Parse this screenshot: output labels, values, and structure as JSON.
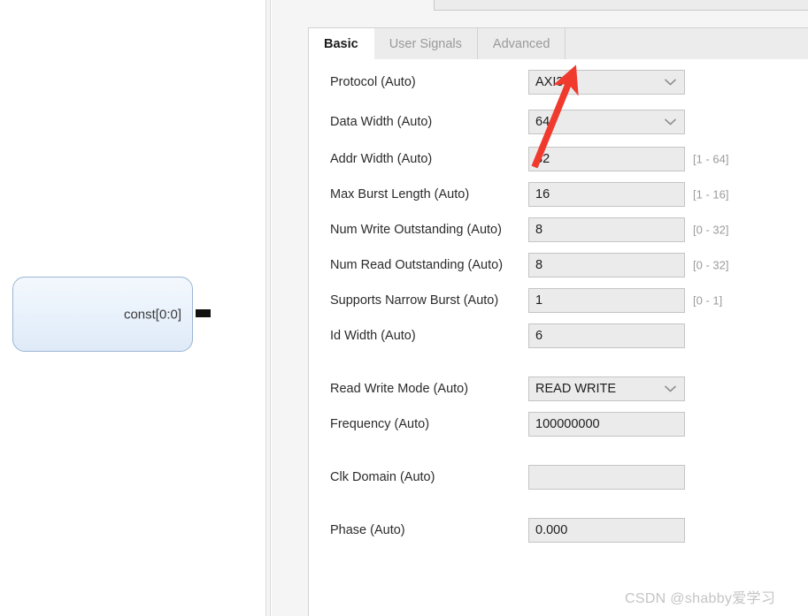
{
  "canvas": {
    "block": {
      "label": "const[0:0]",
      "port_name": "output-port-stub",
      "fill_color": "#e8f1fb",
      "border_color": "#9cb4d4"
    }
  },
  "dialog": {
    "tabs": [
      {
        "label": "Basic",
        "active": true
      },
      {
        "label": "User Signals",
        "active": false
      },
      {
        "label": "Advanced",
        "active": false
      }
    ],
    "fields": [
      {
        "name": "protocol",
        "label": "Protocol (Auto)",
        "type": "combo",
        "value": "AXI3",
        "hint": ""
      },
      {
        "name": "data-width",
        "label": "Data Width (Auto)",
        "type": "combo",
        "value": "64",
        "hint": ""
      },
      {
        "name": "addr-width",
        "label": "Addr Width (Auto)",
        "type": "text",
        "value": "32",
        "hint": "[1 - 64]"
      },
      {
        "name": "max-burst-length",
        "label": "Max Burst Length (Auto)",
        "type": "text",
        "value": "16",
        "hint": "[1 - 16]"
      },
      {
        "name": "num-write-outstanding",
        "label": "Num Write Outstanding (Auto)",
        "type": "text",
        "value": "8",
        "hint": "[0 - 32]"
      },
      {
        "name": "num-read-outstanding",
        "label": "Num Read Outstanding (Auto)",
        "type": "text",
        "value": "8",
        "hint": "[0 - 32]"
      },
      {
        "name": "supports-narrow-burst",
        "label": "Supports Narrow Burst (Auto)",
        "type": "text",
        "value": "1",
        "hint": "[0 - 1]"
      },
      {
        "name": "id-width",
        "label": "Id Width (Auto)",
        "type": "text",
        "value": "6",
        "hint": ""
      },
      {
        "name": "read-write-mode",
        "label": "Read Write Mode (Auto)",
        "type": "combo",
        "value": "READ WRITE",
        "hint": ""
      },
      {
        "name": "frequency",
        "label": "Frequency (Auto)",
        "type": "text",
        "value": "100000000",
        "hint": ""
      },
      {
        "name": "clk-domain",
        "label": "Clk Domain (Auto)",
        "type": "text",
        "value": "",
        "hint": ""
      },
      {
        "name": "phase",
        "label": "Phase (Auto)",
        "type": "text",
        "value": "0.000",
        "hint": ""
      }
    ]
  },
  "annotation": {
    "arrow_color": "#f03a2e"
  },
  "watermark": {
    "text": "CSDN @shabby爱学习"
  }
}
